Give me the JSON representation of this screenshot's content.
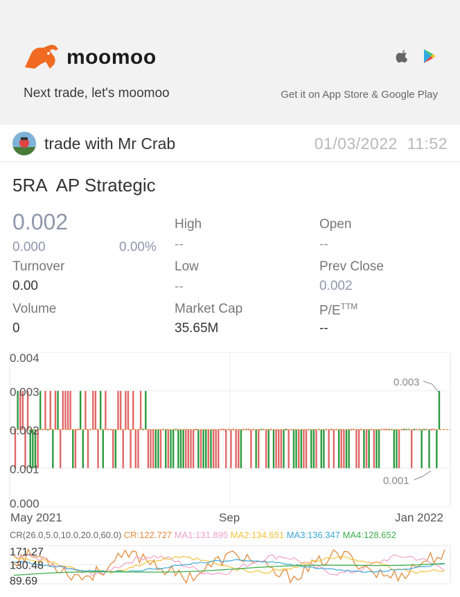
{
  "banner": {
    "logo_text": "moomoo",
    "tagline": "Next trade, let's moomoo",
    "store_text": "Get it on App Store & Google Play"
  },
  "post": {
    "author": "trade with Mr Crab",
    "date": "01/03/2022",
    "time": "11:52"
  },
  "stock": {
    "code": "5RA",
    "name": "AP Strategic",
    "price": "0.002",
    "change": "0.000",
    "change_pct": "0.00%",
    "stats": {
      "high_label": "High",
      "high_value": "--",
      "open_label": "Open",
      "open_value": "--",
      "turnover_label": "Turnover",
      "turnover_value": "0.00",
      "low_label": "Low",
      "low_value": "--",
      "prev_close_label": "Prev Close",
      "prev_close_value": "0.002",
      "volume_label": "Volume",
      "volume_value": "0",
      "market_cap_label": "Market Cap",
      "market_cap_value": "35.65M",
      "pe_label": "P/E",
      "pe_sup": "TTM",
      "pe_value": "--"
    }
  },
  "colors": {
    "up": "#2a9a3c",
    "down": "#e06666",
    "price_gray": "#8e96aa",
    "cr": "#e08a3c",
    "ma1": "#f1a0c4",
    "ma2": "#f2c23a",
    "ma3": "#3aa6d8",
    "ma4": "#3cae4c"
  },
  "chart_data": [
    {
      "type": "candlestick",
      "y_ticks": [
        "0.004",
        "0.003",
        "0.002",
        "0.001",
        "0.000"
      ],
      "ylim": [
        0.0,
        0.004
      ],
      "x_ticks": [
        "May 2021",
        "Sep",
        "Jan 2022"
      ],
      "annotations": {
        "max_label": "0.003",
        "min_label": "0.001"
      },
      "segments": [
        {
          "range": "May 2021 - Jun 2021",
          "low": 0.001,
          "high": 0.003,
          "close_typical": 0.002
        },
        {
          "range": "Jun 2021 - Dec 2021",
          "low": 0.001,
          "high": 0.002,
          "close_typical": 0.002
        },
        {
          "range": "Jan 2022",
          "low": 0.002,
          "high": 0.003,
          "close_last": 0.003
        }
      ],
      "last_value": 0.002
    },
    {
      "type": "line",
      "indicator": "CR(26.0,5.0,10.0,20.0,60.0)",
      "legend": [
        {
          "name": "CR",
          "value": "122.727"
        },
        {
          "name": "MA1",
          "value": "131.895"
        },
        {
          "name": "MA2",
          "value": "134.651"
        },
        {
          "name": "MA3",
          "value": "136.347"
        },
        {
          "name": "MA4",
          "value": "128.652"
        }
      ],
      "y_ticks": [
        "171.27",
        "130.48",
        "89.69"
      ],
      "ylim": [
        89.69,
        171.27
      ]
    }
  ]
}
